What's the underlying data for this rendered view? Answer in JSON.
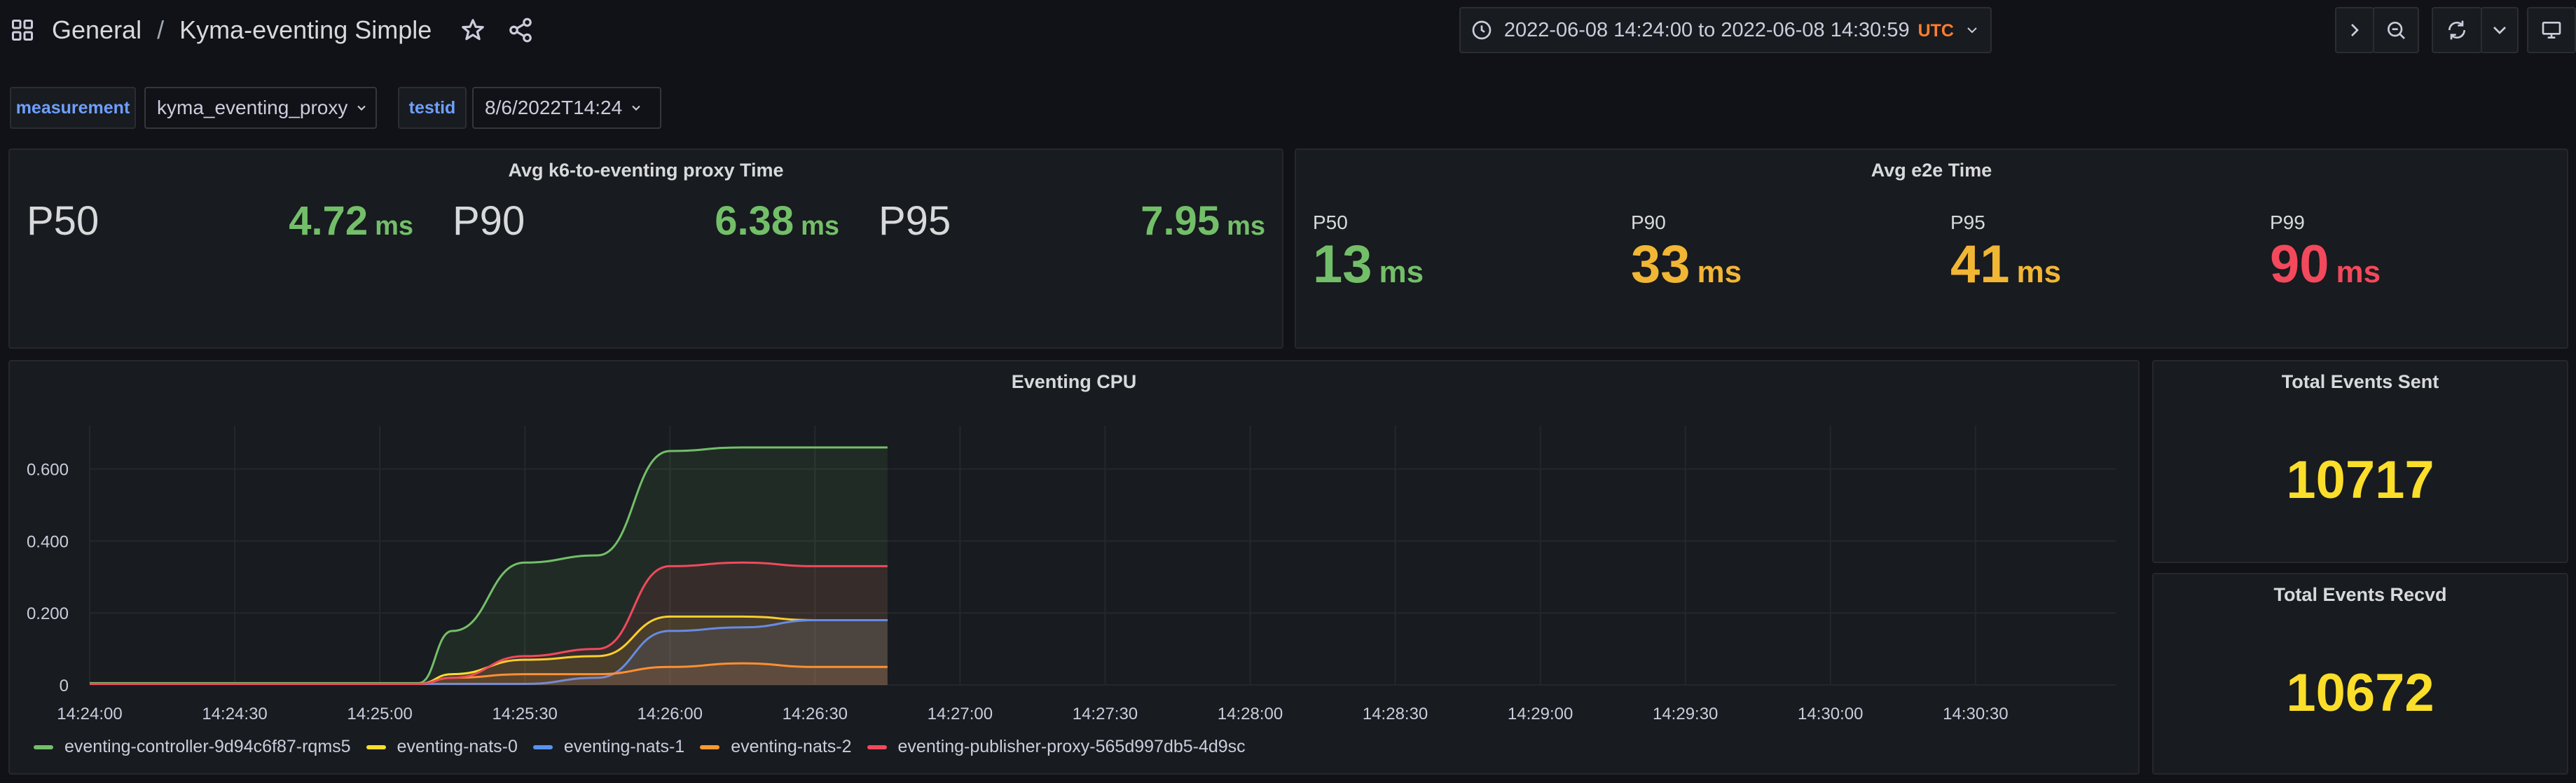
{
  "header": {
    "folder": "General",
    "separator": "/",
    "title": "Kyma-eventing Simple",
    "time_from": "2022-06-08 14:24:00",
    "time_to_word": "to",
    "time_to": "2022-06-08 14:30:59",
    "timezone": "UTC"
  },
  "variables": [
    {
      "label": "measurement",
      "value": "kyma_eventing_proxy"
    },
    {
      "label": "testid",
      "value": "8/6/2022T14:24"
    }
  ],
  "panel_proxy": {
    "title": "Avg k6-to-eventing proxy Time",
    "stats": [
      {
        "label": "P50",
        "value": "4.72",
        "unit": "ms"
      },
      {
        "label": "P90",
        "value": "6.38",
        "unit": "ms"
      },
      {
        "label": "P95",
        "value": "7.95",
        "unit": "ms"
      }
    ],
    "color": "#73bf69"
  },
  "panel_e2e": {
    "title": "Avg e2e Time",
    "stats": [
      {
        "label": "P50",
        "value": "13",
        "unit": "ms",
        "color": "#73bf69"
      },
      {
        "label": "P90",
        "value": "33",
        "unit": "ms",
        "color": "#f2b635"
      },
      {
        "label": "P95",
        "value": "41",
        "unit": "ms",
        "color": "#f2b635"
      },
      {
        "label": "P99",
        "value": "90",
        "unit": "ms",
        "color": "#f2495c"
      }
    ]
  },
  "panel_sent": {
    "title": "Total Events Sent",
    "value": "10717",
    "color": "#fade2a"
  },
  "panel_recvd": {
    "title": "Total Events Recvd",
    "value": "10672",
    "color": "#fade2a"
  },
  "chart_data": {
    "type": "area",
    "title": "Eventing CPU",
    "xlabel": "",
    "ylabel": "",
    "x_ticks": [
      "14:24:00",
      "14:24:30",
      "14:25:00",
      "14:25:30",
      "14:26:00",
      "14:26:30",
      "14:27:00",
      "14:27:30",
      "14:28:00",
      "14:28:30",
      "14:29:00",
      "14:29:30",
      "14:30:00",
      "14:30:30"
    ],
    "y_ticks": [
      "0",
      "0.200",
      "0.400",
      "0.600"
    ],
    "ylim": [
      0,
      0.72
    ],
    "xlim_seconds_from_start": [
      0,
      419
    ],
    "grid": true,
    "legend_position": "bottom-left",
    "x": [
      "14:24:00",
      "14:24:30",
      "14:25:00",
      "14:25:08",
      "14:25:15",
      "14:25:30",
      "14:25:45",
      "14:26:00",
      "14:26:15",
      "14:26:30",
      "14:26:45"
    ],
    "series": [
      {
        "name": "eventing-controller-9d94c6f87-rqms5",
        "color": "#73bf69",
        "values": [
          0.005,
          0.005,
          0.005,
          0.005,
          0.15,
          0.34,
          0.36,
          0.65,
          0.66,
          0.66,
          0.66
        ]
      },
      {
        "name": "eventing-nats-0",
        "color": "#fade2a",
        "values": [
          0.003,
          0.003,
          0.003,
          0.003,
          0.03,
          0.07,
          0.08,
          0.19,
          0.19,
          0.18,
          0.18
        ]
      },
      {
        "name": "eventing-nats-1",
        "color": "#5794f2",
        "values": [
          0.003,
          0.003,
          0.003,
          0.003,
          0.003,
          0.003,
          0.02,
          0.15,
          0.16,
          0.18,
          0.18
        ]
      },
      {
        "name": "eventing-nats-2",
        "color": "#ff9830",
        "values": [
          0.003,
          0.003,
          0.003,
          0.003,
          0.02,
          0.03,
          0.03,
          0.05,
          0.06,
          0.05,
          0.05
        ]
      },
      {
        "name": "eventing-publisher-proxy-565d997db5-4d9sc",
        "color": "#f2495c",
        "values": [
          0.003,
          0.003,
          0.003,
          0.003,
          0.02,
          0.08,
          0.1,
          0.33,
          0.34,
          0.33,
          0.33
        ]
      }
    ]
  }
}
